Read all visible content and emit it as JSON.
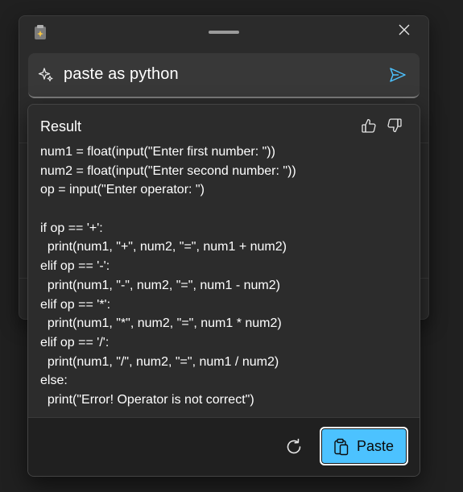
{
  "window": {
    "icon": "clipboard-sparkle-icon",
    "handle": "drag-handle",
    "close_icon": "close-icon"
  },
  "prompt": {
    "icon": "sparkle-icon",
    "text": "paste as python",
    "send_icon": "send-icon"
  },
  "result": {
    "title": "Result",
    "thumb_up_icon": "thumbs-up-icon",
    "thumb_down_icon": "thumbs-down-icon",
    "code_lines": [
      "num1 = float(input(\"Enter first number: \"))",
      "num2 = float(input(\"Enter second number: \"))",
      "op = input(\"Enter operator: \")",
      "",
      "if op == '+':",
      "  print(num1, \"+\", num2, \"=\", num1 + num2)",
      "elif op == '-':",
      "  print(num1, \"-\", num2, \"=\", num1 - num2)",
      "elif op == '*':",
      "  print(num1, \"*\", num2, \"=\", num1 * num2)",
      "elif op == '/':",
      "  print(num1, \"/\", num2, \"=\", num1 / num2)",
      "else:",
      "  print(\"Error! Operator is not correct\")"
    ]
  },
  "footer": {
    "refresh_icon": "refresh-icon",
    "paste_icon": "paste-icon",
    "paste_label": "Paste"
  },
  "colors": {
    "accent": "#4cc2ff",
    "background": "#202020",
    "card": "#2c2c2c",
    "text": "#ffffff"
  }
}
